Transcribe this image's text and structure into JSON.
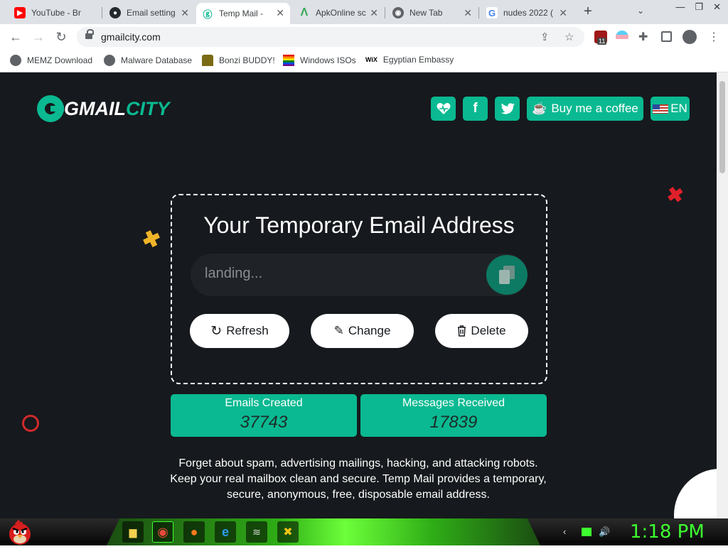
{
  "browser": {
    "tabs": [
      {
        "title": "YouTube - Br",
        "icon": "youtube-icon",
        "color": "#ff0000"
      },
      {
        "title": "Email setting",
        "icon": "github-icon",
        "color": "#24292e"
      },
      {
        "title": "Temp Mail - ",
        "icon": "gmailcity-icon",
        "color": "#0ab991",
        "active": true
      },
      {
        "title": "ApkOnline sc",
        "icon": "apkonline-icon",
        "color": "#34a853"
      },
      {
        "title": "New Tab",
        "icon": "chrome-icon",
        "color": "#5f6368"
      },
      {
        "title": "nudes 2022 (",
        "icon": "google-icon",
        "color": "#4285f4"
      }
    ],
    "new_tab_label": "+",
    "url": "gmailcity.com",
    "extension_badge": "11",
    "bookmarks": [
      {
        "label": "MEMZ Download",
        "icon": "globe-icon"
      },
      {
        "label": "Malware Database",
        "icon": "globe-icon"
      },
      {
        "label": "Bonzi BUDDY!",
        "icon": "bonzi-icon"
      },
      {
        "label": "Windows ISOs",
        "icon": "rainbow-flag-icon"
      },
      {
        "label": "Egyptian Embassy",
        "icon": "wix-icon",
        "icon_text": "WiX"
      }
    ]
  },
  "site": {
    "logo_main": "GMAIL",
    "logo_accent": "CITY",
    "accent_color": "#0ab991",
    "buy_coffee_label": "Buy me a coffee",
    "language_label": "EN",
    "email_title": "Your Temporary Email Address",
    "email_value": "landing...",
    "refresh_label": "Refresh",
    "change_label": "Change",
    "delete_label": "Delete",
    "stats": [
      {
        "label": "Emails Created",
        "value": "37743"
      },
      {
        "label": "Messages Received",
        "value": "17839"
      }
    ],
    "description": "Forget about spam, advertising mailings, hacking, and attacking robots. Keep your real mailbox clean and secure. Temp Mail provides a temporary, secure, anonymous, free, disposable email address."
  },
  "taskbar": {
    "clock": "1:18 PM",
    "clock_color": "#3dff2f"
  }
}
